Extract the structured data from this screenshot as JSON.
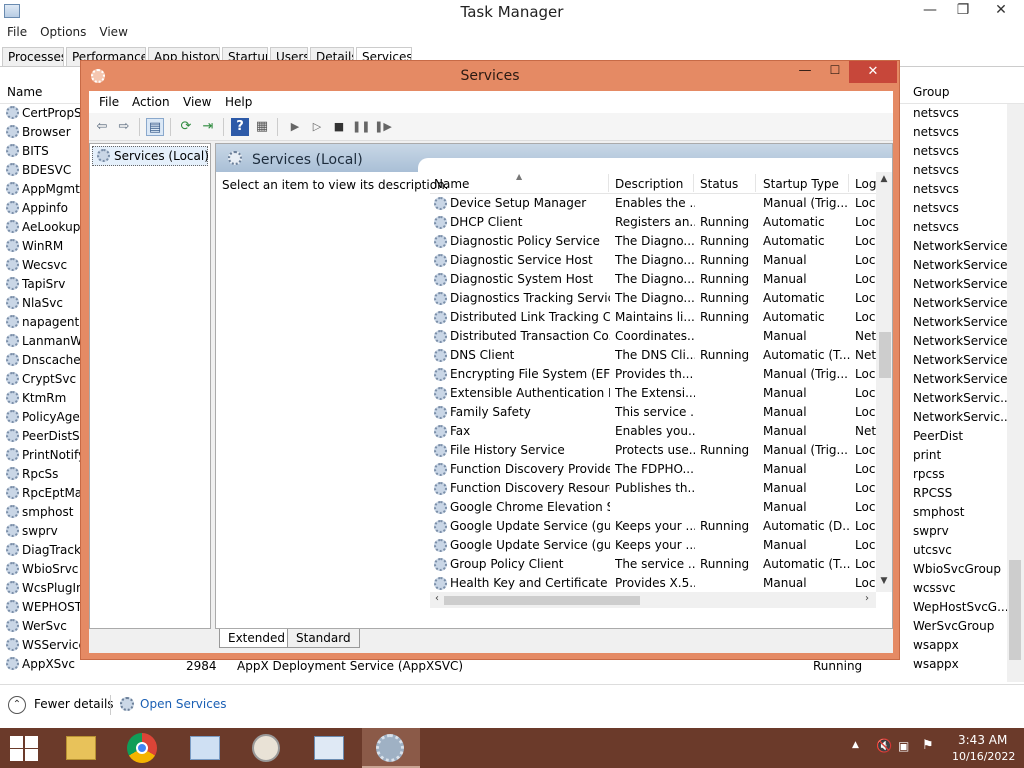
{
  "taskmanager": {
    "title": "Task Manager",
    "window_controls": {
      "minimize": "—",
      "maximize": "❐",
      "close": "✕"
    },
    "menu": [
      "File",
      "Options",
      "View"
    ],
    "tabs": [
      "Processes",
      "Performance",
      "App history",
      "Startup",
      "Users",
      "Details",
      "Services"
    ],
    "active_tab": "Services",
    "columns": {
      "name": "Name",
      "group": "Group"
    },
    "left_names": [
      "CertPropSv",
      "Browser",
      "BITS",
      "BDESVC",
      "AppMgmt",
      "Appinfo",
      "AeLookupS",
      "WinRM",
      "Wecsvc",
      "TapiSrv",
      "NlaSvc",
      "napagent",
      "LanmanWo",
      "Dnscache",
      "CryptSvc",
      "KtmRm",
      "PolicyAger",
      "PeerDistSv",
      "PrintNotify",
      "RpcSs",
      "RpcEptMap",
      "smphost",
      "swprv",
      "DiagTrack",
      "WbioSrvc",
      "WcsPlugIn",
      "WEPHOSTS",
      "WerSvc",
      "WSService",
      "AppXSvc"
    ],
    "right_groups": [
      "netsvcs",
      "netsvcs",
      "netsvcs",
      "netsvcs",
      "netsvcs",
      "netsvcs",
      "netsvcs",
      "NetworkService",
      "NetworkService",
      "NetworkService",
      "NetworkService",
      "NetworkService",
      "NetworkService",
      "NetworkService",
      "NetworkService",
      "NetworkServic...",
      "NetworkServic...",
      "PeerDist",
      "print",
      "rpcss",
      "RPCSS",
      "smphost",
      "swprv",
      "utcsvc",
      "WbioSvcGroup",
      "wcssvc",
      "WepHostSvcG...",
      "WerSvcGroup",
      "wsappx",
      "wsappx"
    ],
    "bottom_row": {
      "name": "AppXSvc",
      "pid": "2984",
      "description": "AppX Deployment Service (AppXSVC)",
      "status": "Running",
      "group": "wsappx"
    },
    "fewer_details": "Fewer details",
    "open_services": "Open Services"
  },
  "services": {
    "title": "Services",
    "window_controls": {
      "minimize": "—",
      "maximize": "☐",
      "close": "✕"
    },
    "menu": [
      "File",
      "Action",
      "View",
      "Help"
    ],
    "tree_item": "Services (Local)",
    "header_title": "Services (Local)",
    "description_prompt": "Select an item to view its description.",
    "columns": [
      "Name",
      "Description",
      "Status",
      "Startup Type",
      "Log"
    ],
    "rows": [
      {
        "name": "Device Setup Manager",
        "desc": "Enables the ...",
        "status": "",
        "startup": "Manual (Trig...",
        "log": "Loc"
      },
      {
        "name": "DHCP Client",
        "desc": "Registers an...",
        "status": "Running",
        "startup": "Automatic",
        "log": "Loc"
      },
      {
        "name": "Diagnostic Policy Service",
        "desc": "The Diagno...",
        "status": "Running",
        "startup": "Automatic",
        "log": "Loc"
      },
      {
        "name": "Diagnostic Service Host",
        "desc": "The Diagno...",
        "status": "Running",
        "startup": "Manual",
        "log": "Loc"
      },
      {
        "name": "Diagnostic System Host",
        "desc": "The Diagno...",
        "status": "Running",
        "startup": "Manual",
        "log": "Loc"
      },
      {
        "name": "Diagnostics Tracking Service",
        "desc": "The Diagno...",
        "status": "Running",
        "startup": "Automatic",
        "log": "Loc"
      },
      {
        "name": "Distributed Link Tracking Cl...",
        "desc": "Maintains li...",
        "status": "Running",
        "startup": "Automatic",
        "log": "Loc"
      },
      {
        "name": "Distributed Transaction Co...",
        "desc": "Coordinates...",
        "status": "",
        "startup": "Manual",
        "log": "Net"
      },
      {
        "name": "DNS Client",
        "desc": "The DNS Cli...",
        "status": "Running",
        "startup": "Automatic (T...",
        "log": "Net"
      },
      {
        "name": "Encrypting File System (EFS)",
        "desc": "Provides th...",
        "status": "",
        "startup": "Manual (Trig...",
        "log": "Loc"
      },
      {
        "name": "Extensible Authentication P...",
        "desc": "The Extensi...",
        "status": "",
        "startup": "Manual",
        "log": "Loc"
      },
      {
        "name": "Family Safety",
        "desc": "This service ...",
        "status": "",
        "startup": "Manual",
        "log": "Loc"
      },
      {
        "name": "Fax",
        "desc": "Enables you...",
        "status": "",
        "startup": "Manual",
        "log": "Net"
      },
      {
        "name": "File History Service",
        "desc": "Protects use...",
        "status": "Running",
        "startup": "Manual (Trig...",
        "log": "Loc"
      },
      {
        "name": "Function Discovery Provide...",
        "desc": "The FDPHO...",
        "status": "",
        "startup": "Manual",
        "log": "Loc"
      },
      {
        "name": "Function Discovery Resourc...",
        "desc": "Publishes th...",
        "status": "",
        "startup": "Manual",
        "log": "Loc"
      },
      {
        "name": "Google Chrome Elevation S...",
        "desc": "",
        "status": "",
        "startup": "Manual",
        "log": "Loc"
      },
      {
        "name": "Google Update Service (gup...",
        "desc": "Keeps your ...",
        "status": "Running",
        "startup": "Automatic (D...",
        "log": "Loc"
      },
      {
        "name": "Google Update Service (gup...",
        "desc": "Keeps your ...",
        "status": "",
        "startup": "Manual",
        "log": "Loc"
      },
      {
        "name": "Group Policy Client",
        "desc": "The service ...",
        "status": "Running",
        "startup": "Automatic (T...",
        "log": "Loc"
      },
      {
        "name": "Health Key and Certificate ...",
        "desc": "Provides X.5...",
        "status": "",
        "startup": "Manual",
        "log": "Loc"
      }
    ],
    "view_tabs": [
      "Extended",
      "Standard"
    ],
    "active_view_tab": "Extended"
  },
  "taskbar": {
    "clock_time": "3:43 AM",
    "clock_date": "10/16/2022",
    "apps": [
      "file-explorer",
      "chrome",
      "control-panel",
      "compass-app",
      "task-manager",
      "services"
    ],
    "active_app": "services"
  },
  "colors": {
    "services_frame": "#e58a64",
    "close_button": "#c7473a",
    "taskbar": "#6b3a2a",
    "link": "#1a5fb4"
  }
}
